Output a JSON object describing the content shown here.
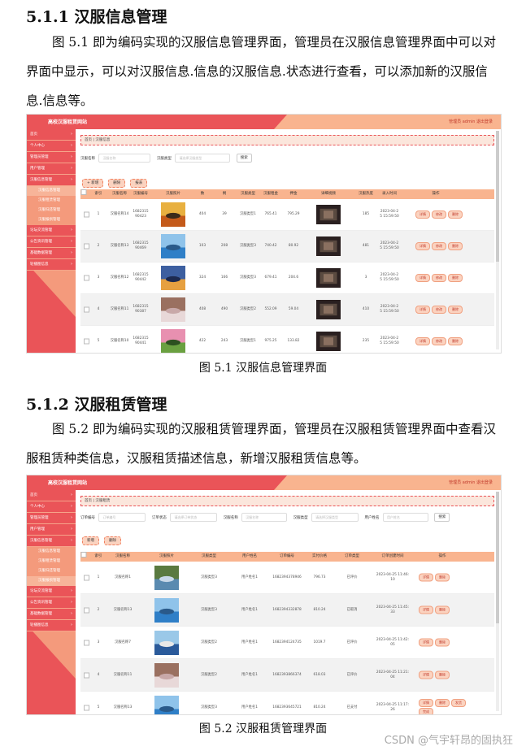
{
  "doc": {
    "h1": "5.1.1  汉服信息管理",
    "p1": "图 5.1 即为编码实现的汉服信息管理界面，管理员在汉服信息管理界面中可以对界面中显示，可以对汉服信息.信息的汉服信息.状态进行查看，可以添加新的汉服信息.信息等。",
    "cap1": "图 5.1  汉服信息管理界面",
    "h2": "5.1.2  汉服租赁管理",
    "p2": "图 5.2 即为编码实现的汉服租赁管理界面，管理员在汉服租赁管理界面中查看汉服租赁种类信息，汉服租赁描述信息，新增汉服租赁信息等。",
    "cap2": "图 5.2  汉服租赁管理界面",
    "watermark": "CSDN @气宇轩昂的固执狂"
  },
  "shot1": {
    "site_title": "高校汉服租赁网站",
    "top_right": "管理员 admin    退出登录",
    "sidebar": [
      {
        "label": "首页",
        "type": "item"
      },
      {
        "label": "个人中心",
        "type": "item"
      },
      {
        "label": "管理员管理",
        "type": "item"
      },
      {
        "label": "用户管理",
        "type": "item"
      },
      {
        "label": "汉服信息管理",
        "type": "item"
      },
      {
        "label": "汉服信息管理",
        "type": "sub",
        "active": true
      },
      {
        "label": "汉服租赁管理",
        "type": "sub"
      },
      {
        "label": "汉服归还管理",
        "type": "sub"
      },
      {
        "label": "汉服报损管理",
        "type": "sub"
      },
      {
        "label": "论坛交流管理",
        "type": "item"
      },
      {
        "label": "公告资讯管理",
        "type": "item"
      },
      {
        "label": "基础数据管理",
        "type": "item"
      },
      {
        "label": "轮播图信息",
        "type": "item"
      }
    ],
    "breadcrumb": "首页 | 汉服信息",
    "filters": {
      "name_label": "汉服名称",
      "name_placeholder": "汉服名称",
      "type_label": "汉服类型",
      "type_placeholder": "请选择汉服类型",
      "search": "搜索"
    },
    "actions": [
      "+ 新增",
      "删除",
      "报表"
    ],
    "columns": [
      "索引",
      "汉服名称",
      "汉服编号",
      "汉服照片",
      "数",
      "剩",
      "汉服类型",
      "汉服租金",
      "押金",
      "详细视频",
      "汉服热度",
      "录入时间",
      "操作"
    ],
    "rows": [
      {
        "idx": "1",
        "name": "汉服名称14",
        "code": "1682315\n90423",
        "a": "404",
        "b": "39",
        "type": "汉服类型1",
        "rent": "765.41",
        "dep": "795.29",
        "heat": "185",
        "time": "2023-04-2\n5 15:59:50",
        "photo": "sunset"
      },
      {
        "idx": "2",
        "name": "汉服名称13",
        "code": "1682315\n90469",
        "a": "103",
        "b": "208",
        "type": "汉服类型3",
        "rent": "740.42",
        "dep": "80.92",
        "heat": "481",
        "time": "2023-04-2\n5 15:59:50",
        "photo": "sea"
      },
      {
        "idx": "3",
        "name": "汉服名称12",
        "code": "1682315\n90442",
        "a": "324",
        "b": "166",
        "type": "汉服类型3",
        "rent": "679.41",
        "dep": "204.6",
        "heat": "3",
        "time": "2023-04-2\n5 15:59:50",
        "photo": "dusk"
      },
      {
        "idx": "4",
        "name": "汉服名称11",
        "code": "1682315\n90387",
        "a": "408",
        "b": "490",
        "type": "汉服类型2",
        "rent": "552.09",
        "dep": "59.04",
        "heat": "410",
        "time": "2023-04-2\n5 15:59:50",
        "photo": "blossom"
      },
      {
        "idx": "5",
        "name": "汉服名称10",
        "code": "1682315\n90441",
        "a": "422",
        "b": "243",
        "type": "汉服类型1",
        "rent": "975.25",
        "dep": "133.82",
        "heat": "235",
        "time": "2023-04-2\n5 15:59:50",
        "photo": "flower"
      }
    ],
    "ops": [
      "详情",
      "修改",
      "删除"
    ]
  },
  "shot2": {
    "site_title": "高校汉服租赁网站",
    "top_right": "管理员 admin    退出登录",
    "sidebar": [
      {
        "label": "首页",
        "type": "item"
      },
      {
        "label": "个人中心",
        "type": "item"
      },
      {
        "label": "管理员管理",
        "type": "item"
      },
      {
        "label": "用户管理",
        "type": "item"
      },
      {
        "label": "汉服信息管理",
        "type": "item"
      },
      {
        "label": "汉服信息管理",
        "type": "sub"
      },
      {
        "label": "汉服租赁管理",
        "type": "sub"
      },
      {
        "label": "汉服归还管理",
        "type": "sub"
      },
      {
        "label": "汉服报损管理",
        "type": "sub",
        "active": true
      },
      {
        "label": "论坛交流管理",
        "type": "item"
      },
      {
        "label": "公告资讯管理",
        "type": "item"
      },
      {
        "label": "基础数据管理",
        "type": "item"
      },
      {
        "label": "轮播图信息",
        "type": "item"
      }
    ],
    "breadcrumb": "首页 | 汉服租赁",
    "filters": {
      "f1_label": "订单编号",
      "f1_placeholder": "订单编号",
      "f2_label": "订单状态",
      "f2_placeholder": "请选择订单状态",
      "f3_label": "汉服名称",
      "f3_placeholder": "汉服名称",
      "f4_label": "汉服类型",
      "f4_placeholder": "请选择汉服类型",
      "f5_label": "用户姓名",
      "f5_placeholder": "用户姓名",
      "search": "搜索"
    },
    "actions": [
      "新增",
      "删除"
    ],
    "columns": [
      "索引",
      "汉服名称",
      "汉服照片",
      "汉服类型",
      "用户姓名",
      "订单编号",
      "实付价格",
      "订单类型",
      "订单创建时间",
      "操作"
    ],
    "rows": [
      {
        "idx": "1",
        "name": "汉服名称1",
        "type": "汉服类型3",
        "user": "用户姓名1",
        "order": "1682394378946",
        "price": "796.73",
        "status": "已评价",
        "time": "2023-04-25 11:46:\n10",
        "photo": "lake",
        "ops": [
          "详情",
          "删除"
        ]
      },
      {
        "idx": "2",
        "name": "汉服名称13",
        "type": "汉服类型3",
        "user": "用户姓名1",
        "order": "1682394332878",
        "price": "810.24",
        "status": "已取消",
        "time": "2023-04-25 11:45:\n33",
        "photo": "sea",
        "ops": [
          "详情",
          "删除"
        ]
      },
      {
        "idx": "3",
        "name": "汉服名称7",
        "type": "汉服类型2",
        "user": "用户姓名1",
        "order": "1682394124735",
        "price": "1019.7",
        "status": "已评价",
        "time": "2023-04-25 11:42:\n05",
        "photo": "sea2",
        "ops": [
          "详情",
          "删除"
        ]
      },
      {
        "idx": "4",
        "name": "汉服名称11",
        "type": "汉服类型2",
        "user": "用户姓名1",
        "order": "1682393866374",
        "price": "618.03",
        "status": "已评价",
        "time": "2023-04-25 11:21:\n04",
        "photo": "blossom",
        "ops": [
          "详情",
          "删除"
        ]
      },
      {
        "idx": "5",
        "name": "汉服名称13",
        "type": "汉服类型3",
        "user": "用户姓名1",
        "order": "1682393645721",
        "price": "810.24",
        "status": "已支付",
        "time": "2023-04-25 11:17:\n26",
        "photo": "sea",
        "ops": [
          "详情",
          "删除",
          "发货",
          "完成"
        ]
      }
    ]
  },
  "photo_colors": {
    "sunset": [
      "#c45a1a",
      "#e8b040",
      "#3a2a1a"
    ],
    "sea": [
      "#2f7fc7",
      "#8fc3ea",
      "#2a5a8a"
    ],
    "dusk": [
      "#e6a040",
      "#3d5fa0",
      "#1d2a50"
    ],
    "blossom": [
      "#e8d8d8",
      "#9a7060",
      "#c8a8a8"
    ],
    "flower": [
      "#6aa040",
      "#e890b0",
      "#2d5020"
    ],
    "lake": [
      "#5a8ab0",
      "#5a7a40",
      "#c8d8e8"
    ],
    "sea2": [
      "#2a5a9a",
      "#9ac8e8",
      "#e8e8e8"
    ]
  }
}
